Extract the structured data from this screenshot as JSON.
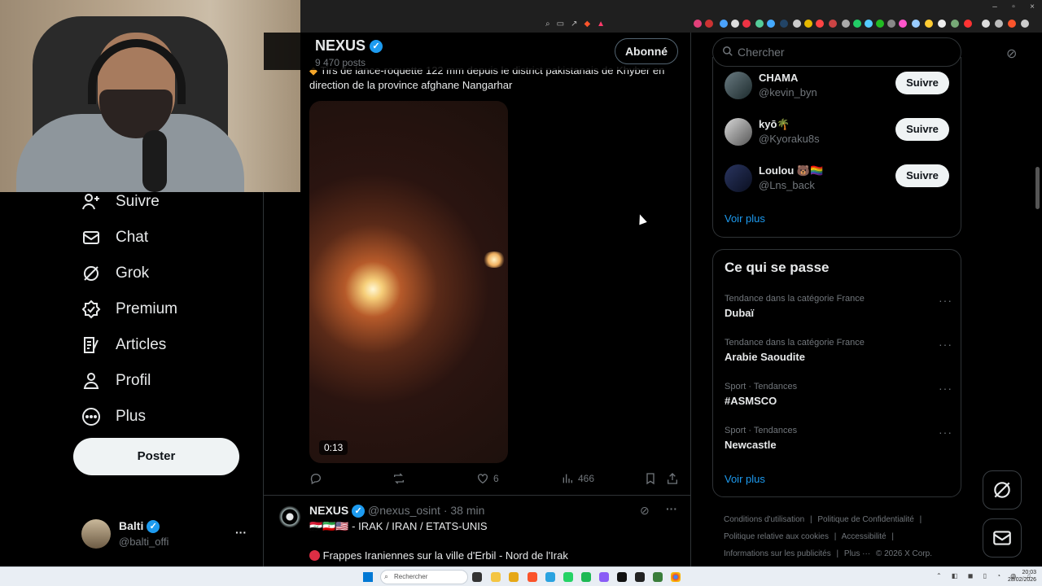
{
  "feed": {
    "account_name": "NEXUS",
    "posts_count": "9 470 posts",
    "follow_button": "Abonné",
    "tweet_text": "Tirs de lance-roquette 122 mm depuis le district pakistanais de Khyber en direction de la province afghane Nangarhar",
    "video_duration": "0:13",
    "actions": {
      "likes": "6",
      "views": "466"
    },
    "post2": {
      "name": "NEXUS",
      "handle": "@nexus_osint",
      "time": "· 38 min",
      "line1": "🇮🇶🇮🇷🇺🇸 - IRAK / IRAN / ETATS-UNIS",
      "line2": "Frappes Iraniennes sur la ville d'Erbil - Nord de l'Irak"
    }
  },
  "nav": {
    "items": [
      {
        "label": "Suivre",
        "icon": "follow-icon"
      },
      {
        "label": "Chat",
        "icon": "mail-icon"
      },
      {
        "label": "Grok",
        "icon": "grok-icon"
      },
      {
        "label": "Premium",
        "icon": "premium-icon"
      },
      {
        "label": "Articles",
        "icon": "articles-icon"
      },
      {
        "label": "Profil",
        "icon": "profile-icon"
      },
      {
        "label": "Plus",
        "icon": "more-icon"
      }
    ],
    "post_button": "Poster",
    "account": {
      "name": "Balti",
      "handle": "@balti_offi",
      "more": "···"
    }
  },
  "sidebar": {
    "search_placeholder": "Chercher",
    "suggestions": [
      {
        "name": "CHAMA",
        "handle": "@kevin_byn",
        "button": "Suivre"
      },
      {
        "name": "kyō🌴",
        "handle": "@Kyoraku8s",
        "button": "Suivre"
      },
      {
        "name": "Loulou 🐻🏳️‍🌈",
        "handle": "@Lns_back",
        "button": "Suivre"
      }
    ],
    "see_more_1": "Voir plus",
    "trends_title": "Ce qui se passe",
    "trends": [
      {
        "category": "Tendance dans la catégorie France",
        "title": "Dubaï"
      },
      {
        "category": "Tendance dans la catégorie France",
        "title": "Arabie Saoudite"
      },
      {
        "category": "Sport · Tendances",
        "title": "#ASMSCO"
      },
      {
        "category": "Sport · Tendances",
        "title": "Newcastle"
      }
    ],
    "see_more_2": "Voir plus",
    "footer": {
      "links": [
        "Conditions d'utilisation",
        "|",
        "Politique de Confidentialité",
        "|",
        "Politique relative aux cookies",
        "|",
        "Accessibilité",
        "|",
        "Informations sur les publicités",
        "|",
        "Plus ···",
        "© 2026 X Corp."
      ]
    }
  },
  "taskbar": {
    "search_placeholder": "Rechercher",
    "time": "20:03",
    "date": "28/02/2026"
  },
  "colors": {
    "accent": "#1d9bf0",
    "background": "#000000",
    "border": "#2f3336"
  }
}
